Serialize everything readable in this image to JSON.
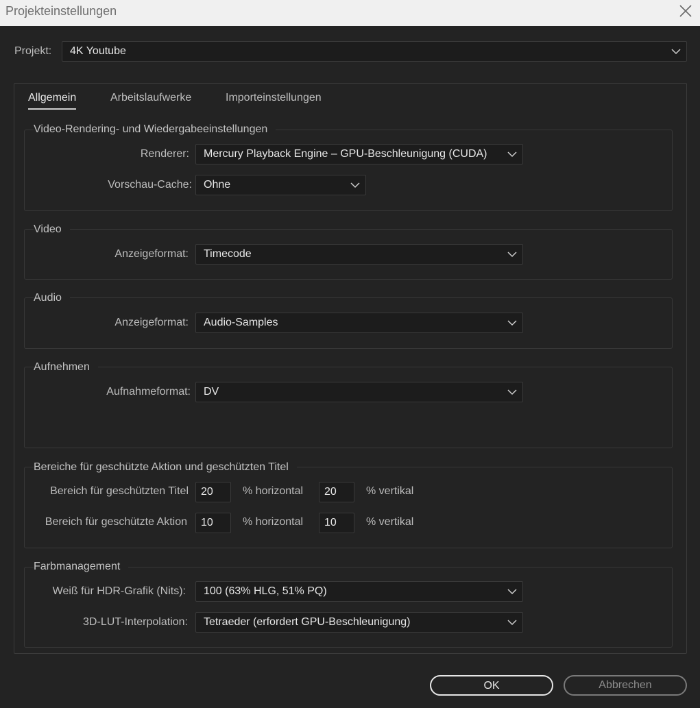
{
  "window": {
    "title": "Projekteinstellungen",
    "close_icon": "close-icon"
  },
  "project": {
    "label": "Projekt:",
    "value": "4K Youtube"
  },
  "tabs": [
    {
      "label": "Allgemein",
      "active": true
    },
    {
      "label": "Arbeitslaufwerke",
      "active": false
    },
    {
      "label": "Importeinstellungen",
      "active": false
    }
  ],
  "video_rendering": {
    "title": "Video-Rendering- und Wiedergabeeinstellungen",
    "renderer_label": "Renderer:",
    "renderer_value": "Mercury Playback Engine – GPU-Beschleunigung (CUDA)",
    "cache_label": "Vorschau-Cache:",
    "cache_value": "Ohne"
  },
  "video": {
    "title": "Video",
    "format_label": "Anzeigeformat:",
    "format_value": "Timecode"
  },
  "audio": {
    "title": "Audio",
    "format_label": "Anzeigeformat:",
    "format_value": "Audio-Samples"
  },
  "capture": {
    "title": "Aufnehmen",
    "format_label": "Aufnahmeformat:",
    "format_value": "DV"
  },
  "safe_areas": {
    "title": "Bereiche für geschützte Aktion und geschützten Titel",
    "title_safe_label": "Bereich für geschützten Titel",
    "title_safe_h": "20",
    "title_safe_v": "20",
    "action_safe_label": "Bereich für geschützte Aktion",
    "action_safe_h": "10",
    "action_safe_v": "10",
    "unit_horizontal": "% horizontal",
    "unit_vertical": "% vertikal"
  },
  "color_management": {
    "title": "Farbmanagement",
    "hdr_white_label": "Weiß für HDR-Grafik (Nits):",
    "hdr_white_value": "100 (63% HLG, 51% PQ)",
    "lut_label": "3D-LUT-Interpolation:",
    "lut_value": "Tetraeder (erfordert GPU-Beschleunigung)"
  },
  "buttons": {
    "ok": "OK",
    "cancel": "Abbrechen"
  },
  "colors": {
    "background": "#232323",
    "field": "#1c1c1c",
    "titlebar": "#f0f0f0"
  }
}
